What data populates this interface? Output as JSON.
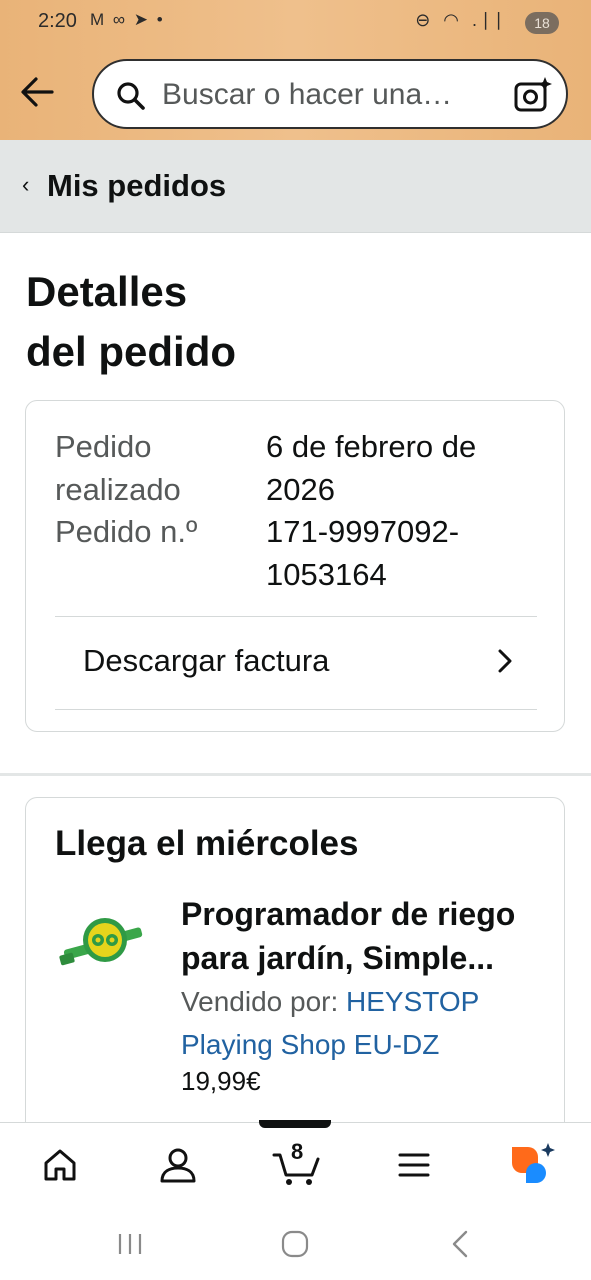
{
  "status_bar": {
    "time": "2:20",
    "left_icons": "M ∞ ➤ •",
    "right_icons": "⊖ ◠ .∣∣",
    "battery": "18"
  },
  "header": {
    "search_placeholder": "Buscar o hacer una…"
  },
  "breadcrumb": {
    "label": "Mis pedidos"
  },
  "page": {
    "title_line1": "Detalles",
    "title_line2": "del pedido"
  },
  "order_summary": {
    "placed_label_1": "Pedido",
    "placed_label_2": "realizado",
    "placed_value_1": "6 de febrero de",
    "placed_value_2": "2026",
    "number_label": "Pedido n.º",
    "number_value_1": "171-9997092-",
    "number_value_2": "1053164",
    "invoice_label": "Descargar factura"
  },
  "shipment": {
    "arrival": "Llega el miércoles",
    "product_title": "Programador de riego para jardín, Simple...",
    "sold_by_label": "Vendido por:",
    "seller": "HEYSTOP Playing Shop EU-DZ",
    "price": "19,99€"
  },
  "bottom_nav": {
    "cart_count": "8",
    "items": [
      "home-icon",
      "account-icon",
      "cart-icon",
      "menu-icon",
      "rufus-icon"
    ]
  },
  "colors": {
    "header_bg": "#efc08c",
    "link": "#2162a1",
    "rufus_orange": "#ff6a1a",
    "rufus_blue": "#1a8cff"
  }
}
